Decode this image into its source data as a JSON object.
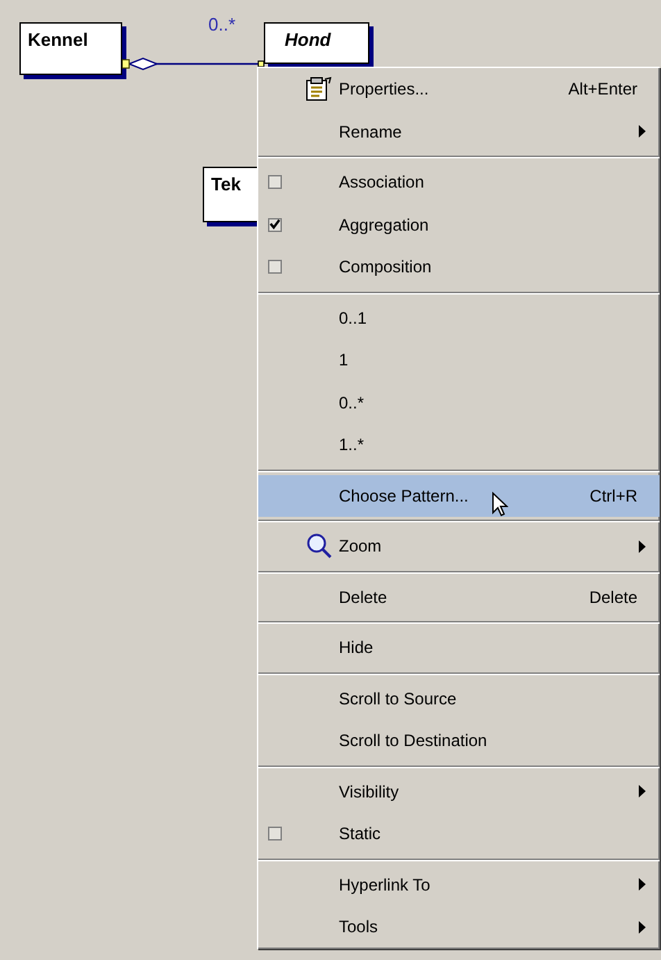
{
  "diagram": {
    "classes": [
      {
        "name": "Kennel",
        "italic": false
      },
      {
        "name": "Hond",
        "italic": true
      },
      {
        "name": "Tek",
        "italic": false
      }
    ],
    "association": {
      "multiplicity": "0..*"
    }
  },
  "context_menu": {
    "groups": [
      [
        {
          "kind": "document",
          "label": "Properties...",
          "shortcut": "Alt+Enter",
          "submenu": false,
          "selected": false
        },
        {
          "kind": "plain",
          "label": "Rename",
          "submenu": true,
          "selected": false
        }
      ],
      [
        {
          "kind": "checkbox",
          "label": "Association",
          "checked": false,
          "submenu": false,
          "selected": false
        },
        {
          "kind": "checkbox",
          "label": "Aggregation",
          "checked": true,
          "submenu": false,
          "selected": false
        },
        {
          "kind": "checkbox",
          "label": "Composition",
          "checked": false,
          "submenu": false,
          "selected": false
        }
      ],
      [
        {
          "kind": "plain",
          "label": "0..1",
          "submenu": false,
          "selected": false
        },
        {
          "kind": "plain",
          "label": "1",
          "submenu": false,
          "selected": false
        },
        {
          "kind": "plain",
          "label": "0..*",
          "submenu": false,
          "selected": false
        },
        {
          "kind": "plain",
          "label": "1..*",
          "submenu": false,
          "selected": false
        }
      ],
      [
        {
          "kind": "plain",
          "label": "Choose Pattern...",
          "shortcut": "Ctrl+R",
          "submenu": false,
          "selected": true
        }
      ],
      [
        {
          "kind": "zoom",
          "label": "Zoom",
          "submenu": true,
          "selected": false
        }
      ],
      [
        {
          "kind": "plain",
          "label": "Delete",
          "shortcut": "Delete",
          "submenu": false,
          "selected": false
        }
      ],
      [
        {
          "kind": "plain",
          "label": "Hide",
          "submenu": false,
          "selected": false
        }
      ],
      [
        {
          "kind": "plain",
          "label": "Scroll to Source",
          "submenu": false,
          "selected": false
        },
        {
          "kind": "plain",
          "label": "Scroll to Destination",
          "submenu": false,
          "selected": false
        }
      ],
      [
        {
          "kind": "plain",
          "label": "Visibility",
          "submenu": true,
          "selected": false
        },
        {
          "kind": "checkbox",
          "label": "Static",
          "checked": false,
          "submenu": false,
          "selected": false
        }
      ],
      [
        {
          "kind": "plain",
          "label": "Hyperlink To",
          "submenu": true,
          "selected": false
        },
        {
          "kind": "plain",
          "label": "Tools",
          "submenu": true,
          "selected": false
        }
      ]
    ]
  }
}
